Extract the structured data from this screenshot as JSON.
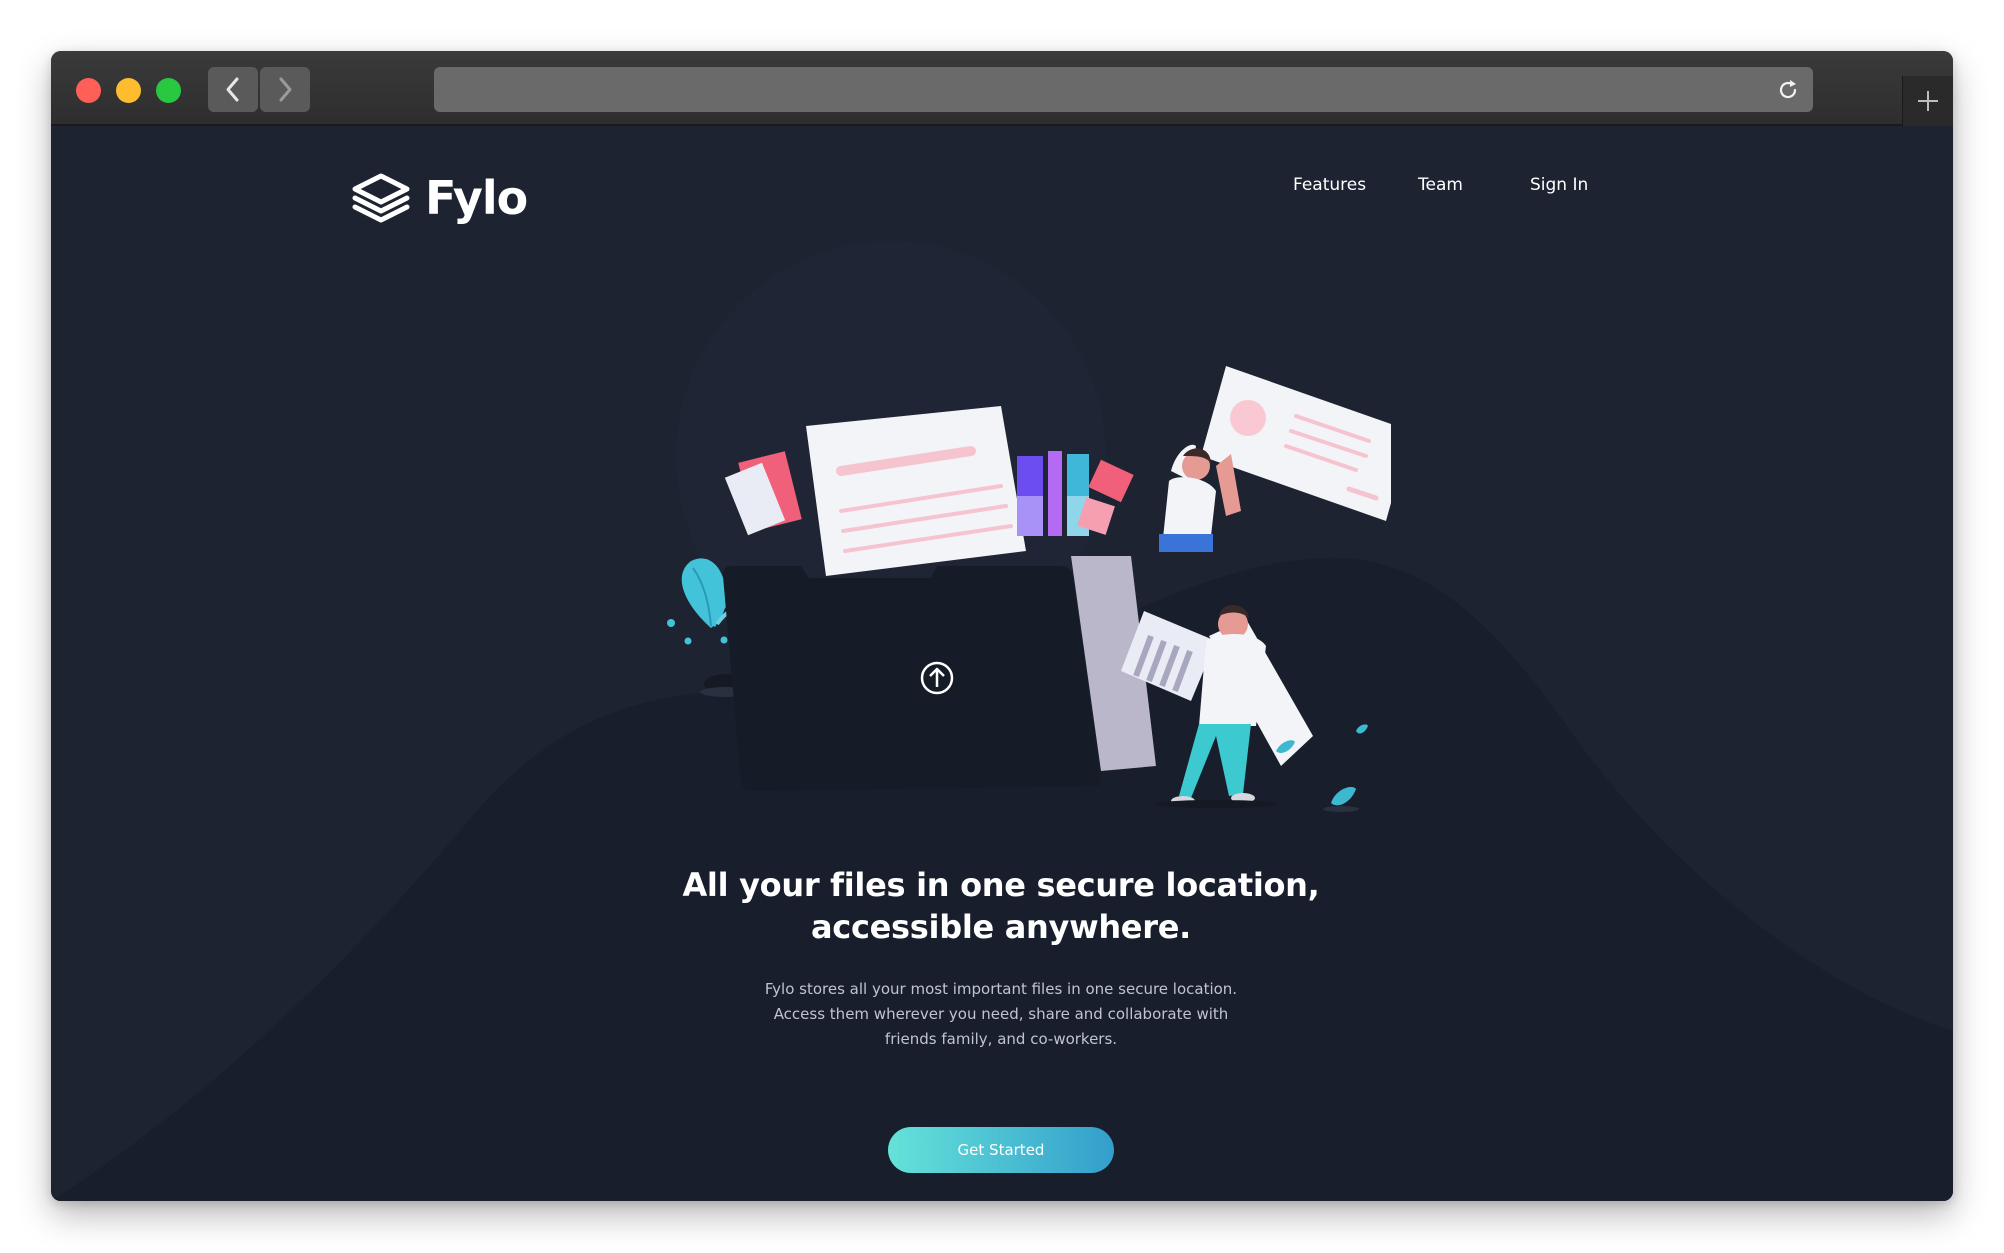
{
  "browser": {
    "traffic_lights": {
      "close_color": "#fe5f57",
      "minimize_color": "#febc2e",
      "maximize_color": "#28c840"
    },
    "address_value": ""
  },
  "header": {
    "logo_text": "Fylo",
    "nav": [
      {
        "label": "Features"
      },
      {
        "label": "Team"
      },
      {
        "label": "Sign In"
      }
    ]
  },
  "hero": {
    "headline_line1": "All your files in one secure location,",
    "headline_line2": "accessible anywhere.",
    "description_line1": "Fylo stores all your most important files in one secure location.",
    "description_line2": "Access them wherever you need, share and collaborate with",
    "description_line3": "friends family, and co-workers.",
    "cta_label": "Get Started"
  },
  "theme": {
    "background": "#1d2331",
    "hill": "#181e2b",
    "cta_gradient_start": "#65e2d9",
    "cta_gradient_end": "#339ecc"
  }
}
